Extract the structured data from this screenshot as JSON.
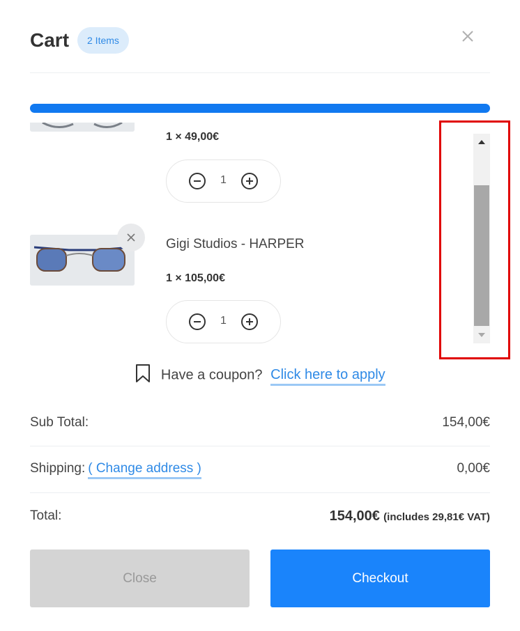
{
  "header": {
    "title": "Cart",
    "badge": "2 Items"
  },
  "progress": {
    "fraction": 1.0
  },
  "items": [
    {
      "name": "",
      "price_line": "1 × 49,00€",
      "quantity": "1"
    },
    {
      "name": "Gigi Studios - HARPER",
      "price_line": "1 × 105,00€",
      "quantity": "1"
    }
  ],
  "coupon": {
    "text": "Have a coupon?",
    "link": "Click here to apply"
  },
  "summary": {
    "subtotal_label": "Sub Total:",
    "subtotal_value": "154,00€",
    "shipping_label": "Shipping:",
    "shipping_link": "( Change address )",
    "shipping_value": "0,00€",
    "total_label": "Total:",
    "total_value": "154,00€",
    "total_vat": "(includes 29,81€ VAT)"
  },
  "buttons": {
    "close": "Close",
    "checkout": "Checkout"
  },
  "colors": {
    "accent": "#1a84fb",
    "progress": "#1179f0",
    "badge_bg": "#dcecfb",
    "link": "#2f8ae6",
    "highlight": "#e00000"
  }
}
